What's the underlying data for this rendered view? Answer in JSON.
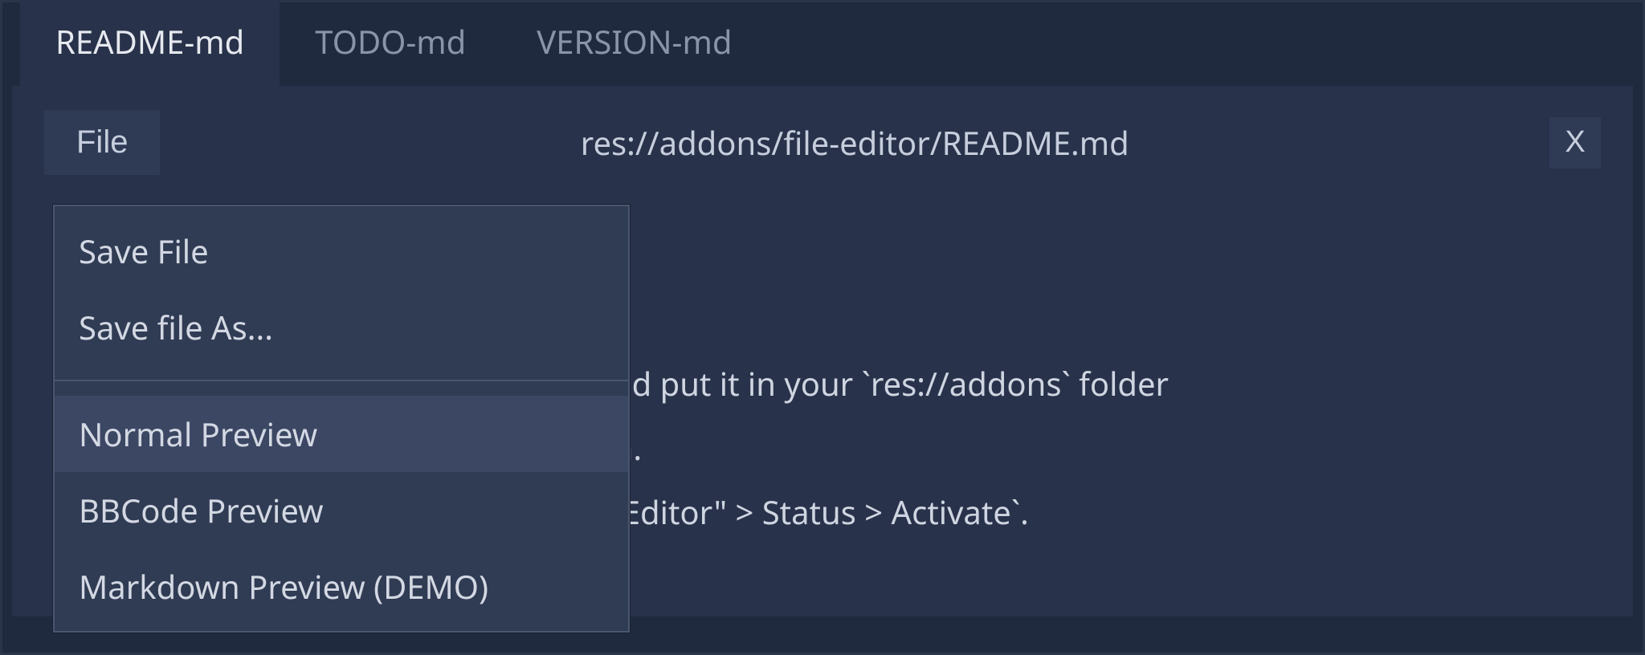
{
  "tabs": [
    {
      "label": "README-md",
      "active": true
    },
    {
      "label": "TODO-md",
      "active": false
    },
    {
      "label": "VERSION-md",
      "active": false
    }
  ],
  "toolbar": {
    "file_label": "File",
    "path": "res://addons/file-editor/README.md",
    "close_label": "X"
  },
  "file_menu": {
    "save_file": "Save File",
    "save_file_as": "Save file As...",
    "normal_preview": "Normal Preview",
    "bbcode_preview": "BBCode Preview",
    "markdown_preview": "Markdown Preview (DEMO)"
  },
  "editor_lines": {
    "l1": "repository and put it in your `res://addons` folder",
    "l2": "nt to work on.",
    "l3": "ugins > \"File Editor\" > Status > Activate`."
  }
}
